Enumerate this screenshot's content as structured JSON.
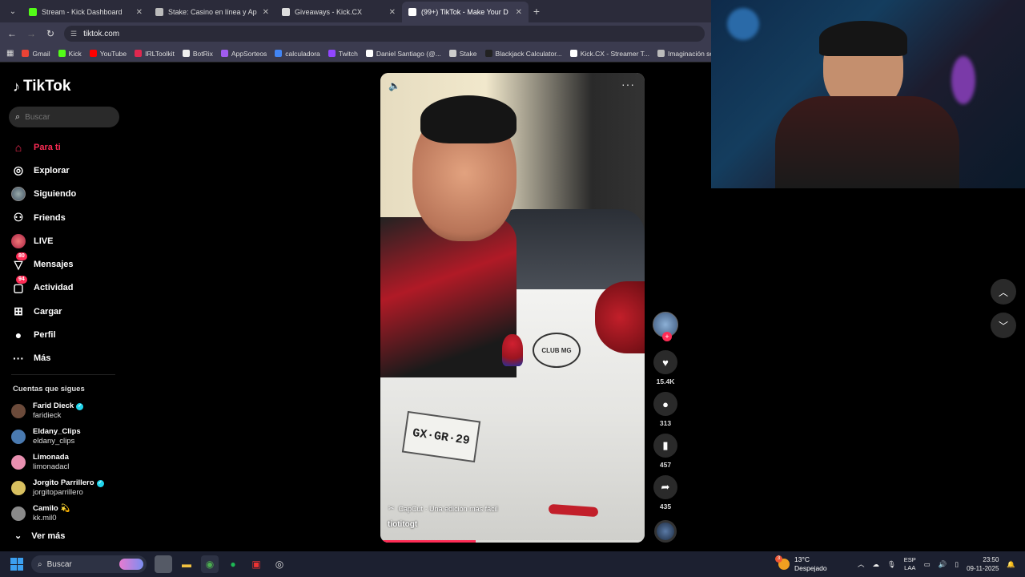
{
  "browser": {
    "tabs": [
      {
        "label": "Stream - Kick Dashboard",
        "color": "#53fc18",
        "active": false
      },
      {
        "label": "Stake: Casino en línea y Ap",
        "color": "#bbbbbb",
        "active": false
      },
      {
        "label": "Giveaways - Kick.CX",
        "color": "#dddddd",
        "active": false
      },
      {
        "label": "(99+) TikTok - Make Your D",
        "color": "#ffffff",
        "active": true
      }
    ],
    "new_tab": "+",
    "url": "tiktok.com",
    "bookmarks": [
      {
        "label": "Gmail",
        "color": "#ea4335"
      },
      {
        "label": "Kick",
        "color": "#53fc18"
      },
      {
        "label": "YouTube",
        "color": "#ff0000"
      },
      {
        "label": "IRLToolkit",
        "color": "#e0284f"
      },
      {
        "label": "BotRix",
        "color": "#eeeeee"
      },
      {
        "label": "AppSorteos",
        "color": "#a05cf0"
      },
      {
        "label": "calculadora",
        "color": "#4285f4"
      },
      {
        "label": "Twitch",
        "color": "#9146ff"
      },
      {
        "label": "Daniel Santiago (@...",
        "color": "#ffffff"
      },
      {
        "label": "Stake",
        "color": "#cccccc"
      },
      {
        "label": "Blackjack Calculator...",
        "color": "#222222"
      },
      {
        "label": "Kick.CX - Streamer T...",
        "color": "#ffffff"
      },
      {
        "label": "Imaginación so",
        "color": "#bbbbbb"
      }
    ]
  },
  "tiktok": {
    "brand": "TikTok",
    "search_placeholder": "Buscar",
    "nav": [
      {
        "label": "Para ti",
        "icon": "home-icon",
        "active": true,
        "badge": ""
      },
      {
        "label": "Explorar",
        "icon": "compass-icon",
        "active": false,
        "badge": ""
      },
      {
        "label": "Siguiendo",
        "icon": "following-avatar-icon",
        "active": false,
        "badge": ""
      },
      {
        "label": "Friends",
        "icon": "friends-icon",
        "active": false,
        "badge": ""
      },
      {
        "label": "LIVE",
        "icon": "live-icon",
        "active": false,
        "badge": ""
      },
      {
        "label": "Mensajes",
        "icon": "message-icon",
        "active": false,
        "badge": "80"
      },
      {
        "label": "Actividad",
        "icon": "activity-icon",
        "active": false,
        "badge": "94"
      },
      {
        "label": "Cargar",
        "icon": "upload-icon",
        "active": false,
        "badge": ""
      },
      {
        "label": "Perfil",
        "icon": "profile-icon",
        "active": false,
        "badge": ""
      },
      {
        "label": "Más",
        "icon": "more-icon",
        "active": false,
        "badge": ""
      }
    ],
    "following_title": "Cuentas que sigues",
    "following": [
      {
        "name": "Farid Dieck",
        "handle": "faridieck",
        "verified": true,
        "emoji": "",
        "color": "#6b4a3a"
      },
      {
        "name": "Eldany_Clips",
        "handle": "eldany_clips",
        "verified": false,
        "emoji": "",
        "color": "#4a7ab0"
      },
      {
        "name": "Limonada",
        "handle": "limonadacl",
        "verified": false,
        "emoji": "",
        "color": "#e890b0"
      },
      {
        "name": "Jorgito Parrillero",
        "handle": "jorgitoparrillero",
        "verified": true,
        "emoji": "",
        "color": "#d8c060"
      },
      {
        "name": "Camilo",
        "handle": "kk.mil0",
        "verified": false,
        "emoji": "💫",
        "color": "#8a8a8a"
      }
    ],
    "see_more": "Ver más",
    "video": {
      "plate": "GX·GR·29",
      "club": "CLUB MG",
      "capcut": "CapCut · Una edición más fácil",
      "author": "tiotitogt",
      "progress": 0.36
    },
    "actions": {
      "likes": "15.4K",
      "comments": "313",
      "saves": "457",
      "shares": "435"
    }
  },
  "taskbar": {
    "search": "Buscar",
    "weather_temp": "13°C",
    "weather_desc": "Despejado",
    "weather_badge": "3",
    "lang_top": "ESP",
    "lang_bottom": "LAA",
    "time": "23:50",
    "date": "09-11-2025"
  }
}
